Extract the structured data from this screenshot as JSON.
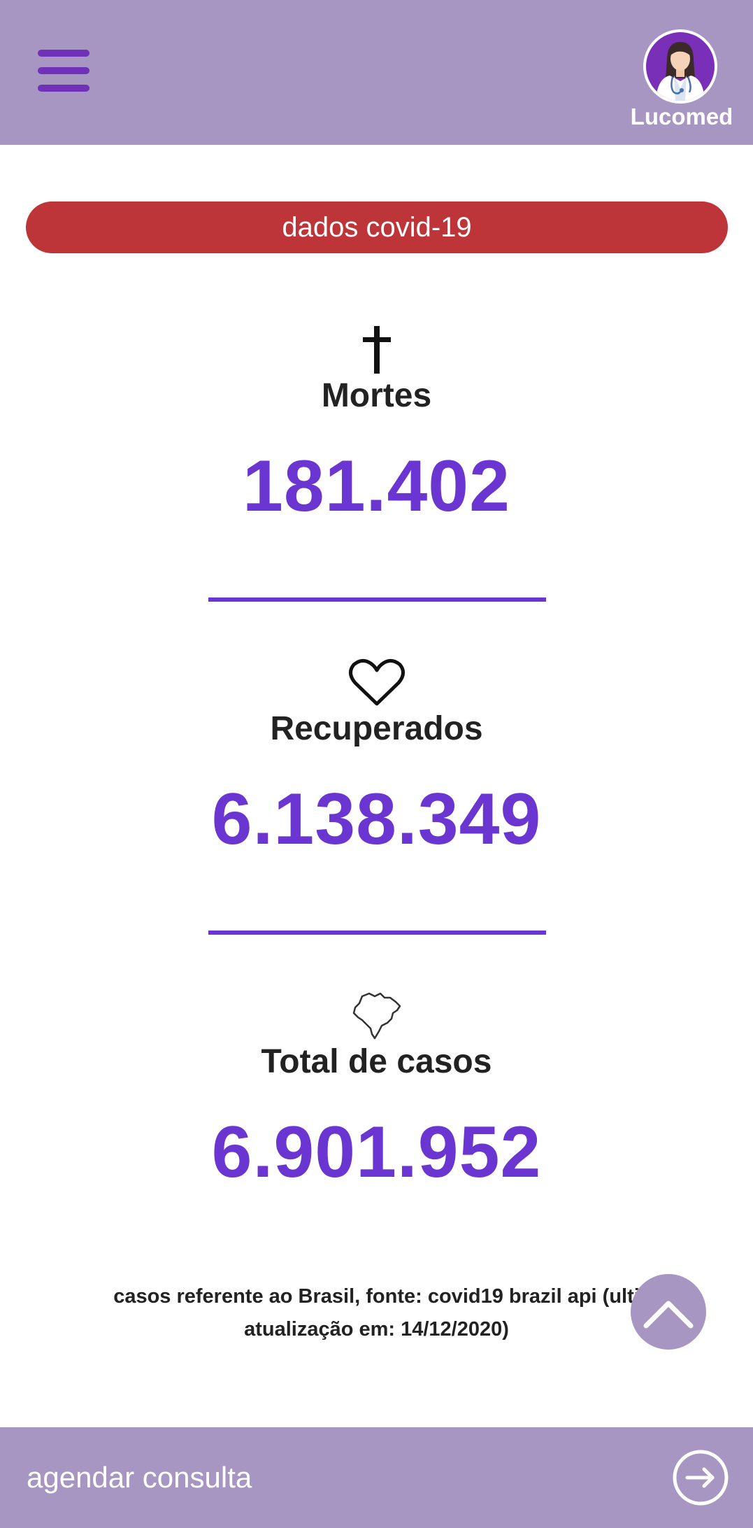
{
  "header": {
    "brand": "Lucomed",
    "menu_icon": "hamburger-menu-icon",
    "avatar_icon": "doctor-avatar-icon",
    "background_color": "#a896c2",
    "accent_color": "#7030b8"
  },
  "banner": {
    "label": "dados covid-19",
    "color": "#bd3539"
  },
  "stats": [
    {
      "icon": "cross-icon",
      "label": "Mortes",
      "value": "181.402"
    },
    {
      "icon": "heart-icon",
      "label": "Recuperados",
      "value": "6.138.349"
    },
    {
      "icon": "brazil-map-icon",
      "label": "Total de casos",
      "value": "6.901.952"
    }
  ],
  "value_color": "#6a35d0",
  "footnote": {
    "line1": "casos referente ao Brasil, fonte: covid19 brazil api (ulti",
    "line2": "atualização em: 14/12/2020)"
  },
  "scroll_top_button": {
    "icon": "chevron-up-icon"
  },
  "bottom_bar": {
    "label": "agendar consulta",
    "icon": "arrow-right-circle-icon"
  }
}
